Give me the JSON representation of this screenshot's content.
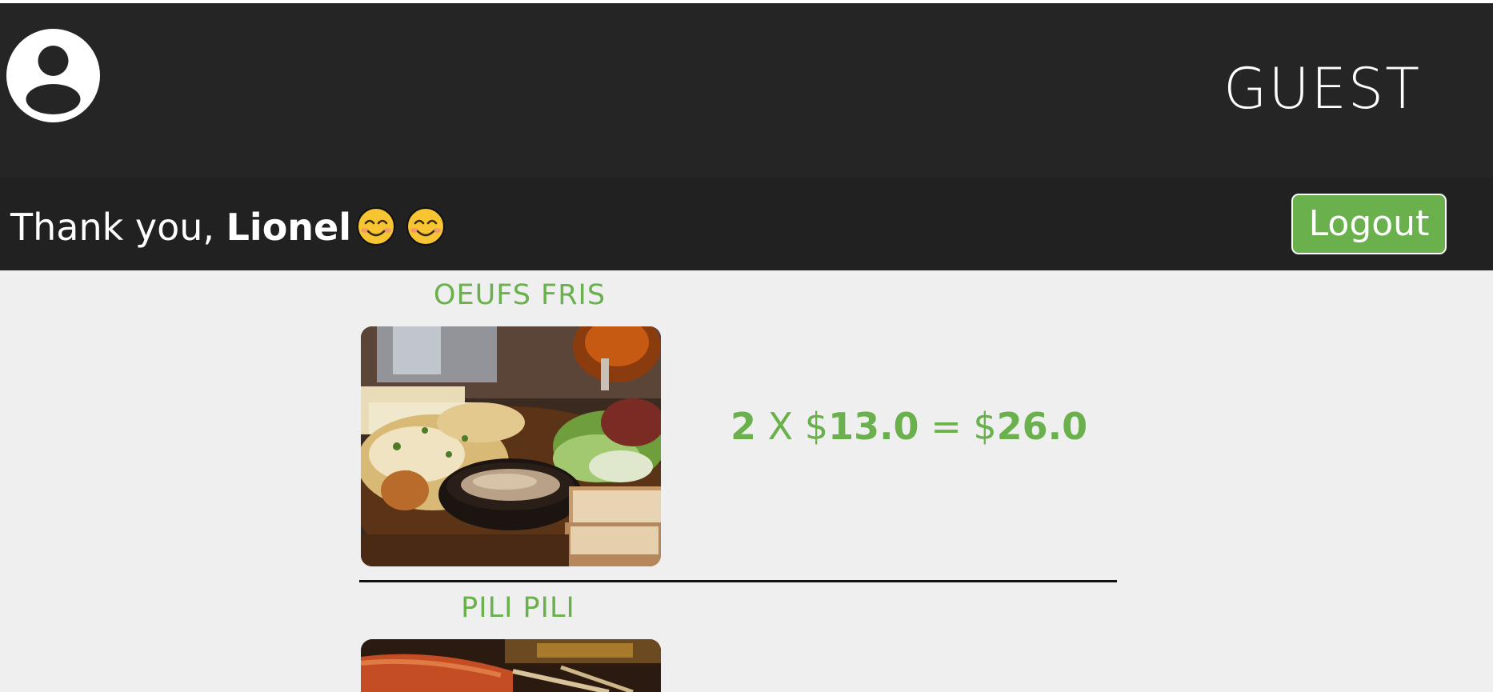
{
  "header": {
    "avatar_icon": "user-circle-icon",
    "role_label": "GUEST"
  },
  "subheader": {
    "thanks_prefix": "Thank you, ",
    "user_name": "Lionel",
    "emoji_icon": "smiling-face-icon",
    "logout_label": "Logout"
  },
  "colors": {
    "accent": "#6ab04c",
    "header_bg": "#252525",
    "subheader_bg": "#212121",
    "page_bg": "#efefef"
  },
  "order_items": [
    {
      "title": "OEUFS FRIS",
      "quantity": "2",
      "times": "X",
      "currency": "$",
      "unit_price": "13.0",
      "equals": "=",
      "total": "26.0"
    },
    {
      "title": "PILI PILI"
    }
  ]
}
